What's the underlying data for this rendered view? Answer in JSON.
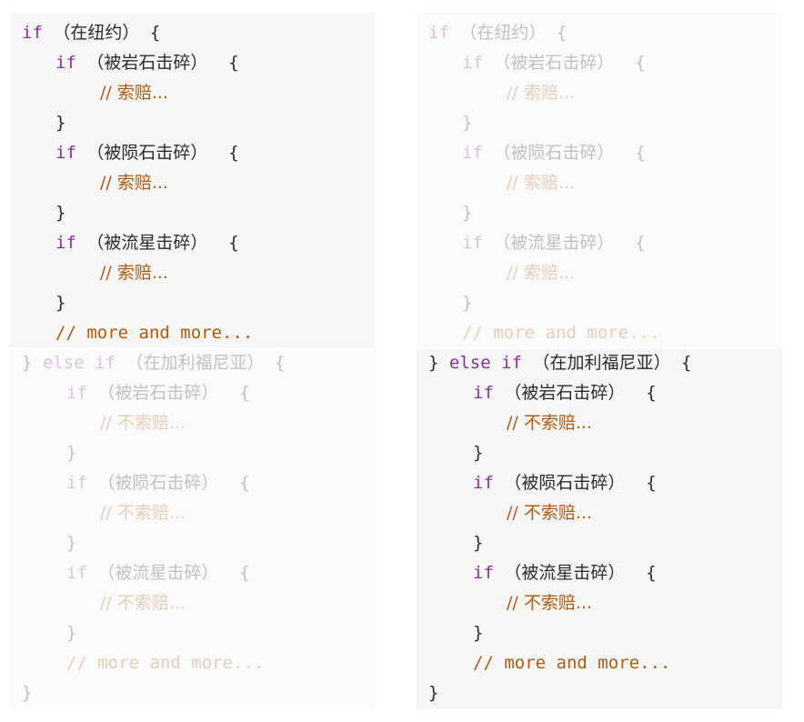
{
  "colors": {
    "keyword": "#8b2f97",
    "comment": "#b4590b",
    "text": "#2b2b2b",
    "active_background": "#f6f6f6",
    "dimmed_background": "#fbfbfb"
  },
  "left": {
    "ny_block": {
      "if_kw": "if",
      "cond": "（在纽约）",
      "brace": "{",
      "cases": [
        {
          "if_kw": "if",
          "cond": "（被岩石击碎）",
          "brace": "{",
          "comment": "// 索赔...",
          "close": "}"
        },
        {
          "if_kw": "if",
          "cond": "（被陨石击碎）",
          "brace": "{",
          "comment": "// 索赔...",
          "close": "}"
        },
        {
          "if_kw": "if",
          "cond": "（被流星击碎）",
          "brace": "{",
          "comment": "// 索赔...",
          "close": "}"
        }
      ],
      "more": "// more and more..."
    },
    "ca_block": {
      "close_prefix": "}",
      "else_kw": "else",
      "if_kw": "if",
      "cond": "（在加利福尼亚）",
      "brace": "{",
      "cases": [
        {
          "if_kw": "if",
          "cond": "（被岩石击碎）",
          "brace": "{",
          "comment": "// 不索赔...",
          "close": "}"
        },
        {
          "if_kw": "if",
          "cond": "（被陨石击碎）",
          "brace": "{",
          "comment": "// 不索赔...",
          "close": "}"
        },
        {
          "if_kw": "if",
          "cond": "（被流星击碎）",
          "brace": "{",
          "comment": "// 不索赔...",
          "close": "}"
        }
      ],
      "more": "// more and more...",
      "final_close": "}"
    }
  },
  "right": {
    "ny_block": {
      "if_kw": "if",
      "cond": "（在纽约）",
      "brace": "{",
      "cases": [
        {
          "if_kw": "if",
          "cond": "（被岩石击碎）",
          "brace": "{",
          "comment": "// 索赔...",
          "close": "}"
        },
        {
          "if_kw": "if",
          "cond": "（被陨石击碎）",
          "brace": "{",
          "comment": "// 索赔...",
          "close": "}"
        },
        {
          "if_kw": "if",
          "cond": "（被流星击碎）",
          "brace": "{",
          "comment": "// 索赔...",
          "close": "}"
        }
      ],
      "more": "// more and more..."
    },
    "ca_block": {
      "close_prefix": "}",
      "else_kw": "else",
      "if_kw": "if",
      "cond": "（在加利福尼亚）",
      "brace": "{",
      "cases": [
        {
          "if_kw": "if",
          "cond": "（被岩石击碎）",
          "brace": "{",
          "comment": "// 不索赔...",
          "close": "}"
        },
        {
          "if_kw": "if",
          "cond": "（被陨石击碎）",
          "brace": "{",
          "comment": "// 不索赔...",
          "close": "}"
        },
        {
          "if_kw": "if",
          "cond": "（被流星击碎）",
          "brace": "{",
          "comment": "// 不索赔...",
          "close": "}"
        }
      ],
      "more": "// more and more...",
      "final_close": "}"
    }
  }
}
